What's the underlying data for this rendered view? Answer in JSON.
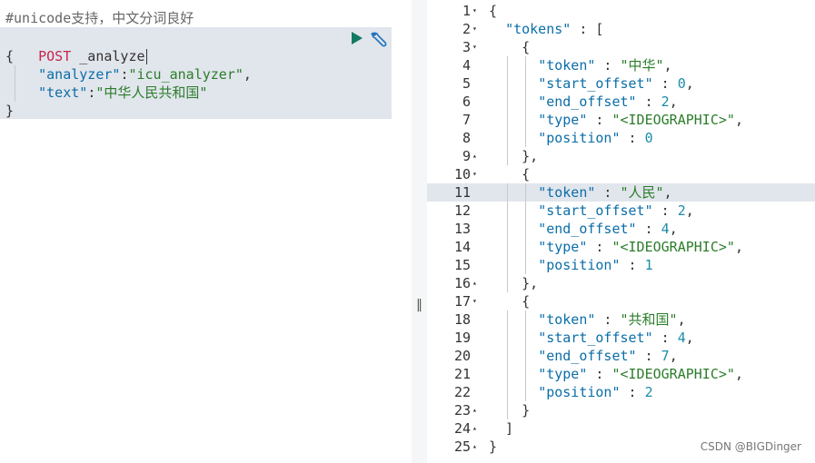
{
  "request": {
    "comment": "#unicode支持，中文分词良好",
    "method": "POST",
    "path": "_analyze",
    "open_brace": "{",
    "body_line1": "    \"analyzer\":\"icu_analyzer\",",
    "body_line2": "    \"text\":\"中华人民共和国\"",
    "close_brace": "}"
  },
  "toolbar": {
    "run_icon": "play-icon",
    "settings_icon": "wrench-icon"
  },
  "splitter": {
    "handle": "‖"
  },
  "response": {
    "active_line": 11,
    "lines": [
      {
        "n": "1",
        "fold": "▾",
        "text": "{"
      },
      {
        "n": "2",
        "fold": "▾",
        "text": "  \"tokens\" : ["
      },
      {
        "n": "3",
        "fold": "▾",
        "text": "    {"
      },
      {
        "n": "4",
        "fold": "",
        "text": "      \"token\" : \"中华\","
      },
      {
        "n": "5",
        "fold": "",
        "text": "      \"start_offset\" : 0,"
      },
      {
        "n": "6",
        "fold": "",
        "text": "      \"end_offset\" : 2,"
      },
      {
        "n": "7",
        "fold": "",
        "text": "      \"type\" : \"<IDEOGRAPHIC>\","
      },
      {
        "n": "8",
        "fold": "",
        "text": "      \"position\" : 0"
      },
      {
        "n": "9",
        "fold": "▴",
        "text": "    },"
      },
      {
        "n": "10",
        "fold": "▾",
        "text": "    {"
      },
      {
        "n": "11",
        "fold": "",
        "text": "      \"token\" : \"人民\","
      },
      {
        "n": "12",
        "fold": "",
        "text": "      \"start_offset\" : 2,"
      },
      {
        "n": "13",
        "fold": "",
        "text": "      \"end_offset\" : 4,"
      },
      {
        "n": "14",
        "fold": "",
        "text": "      \"type\" : \"<IDEOGRAPHIC>\","
      },
      {
        "n": "15",
        "fold": "",
        "text": "      \"position\" : 1"
      },
      {
        "n": "16",
        "fold": "▴",
        "text": "    },"
      },
      {
        "n": "17",
        "fold": "▾",
        "text": "    {"
      },
      {
        "n": "18",
        "fold": "",
        "text": "      \"token\" : \"共和国\","
      },
      {
        "n": "19",
        "fold": "",
        "text": "      \"start_offset\" : 4,"
      },
      {
        "n": "20",
        "fold": "",
        "text": "      \"end_offset\" : 7,"
      },
      {
        "n": "21",
        "fold": "",
        "text": "      \"type\" : \"<IDEOGRAPHIC>\","
      },
      {
        "n": "22",
        "fold": "",
        "text": "      \"position\" : 2"
      },
      {
        "n": "23",
        "fold": "▴",
        "text": "    }"
      },
      {
        "n": "24",
        "fold": "▴",
        "text": "  ]"
      },
      {
        "n": "25",
        "fold": "▴",
        "text": "}"
      }
    ]
  },
  "watermark": "CSDN @BIGDinger"
}
